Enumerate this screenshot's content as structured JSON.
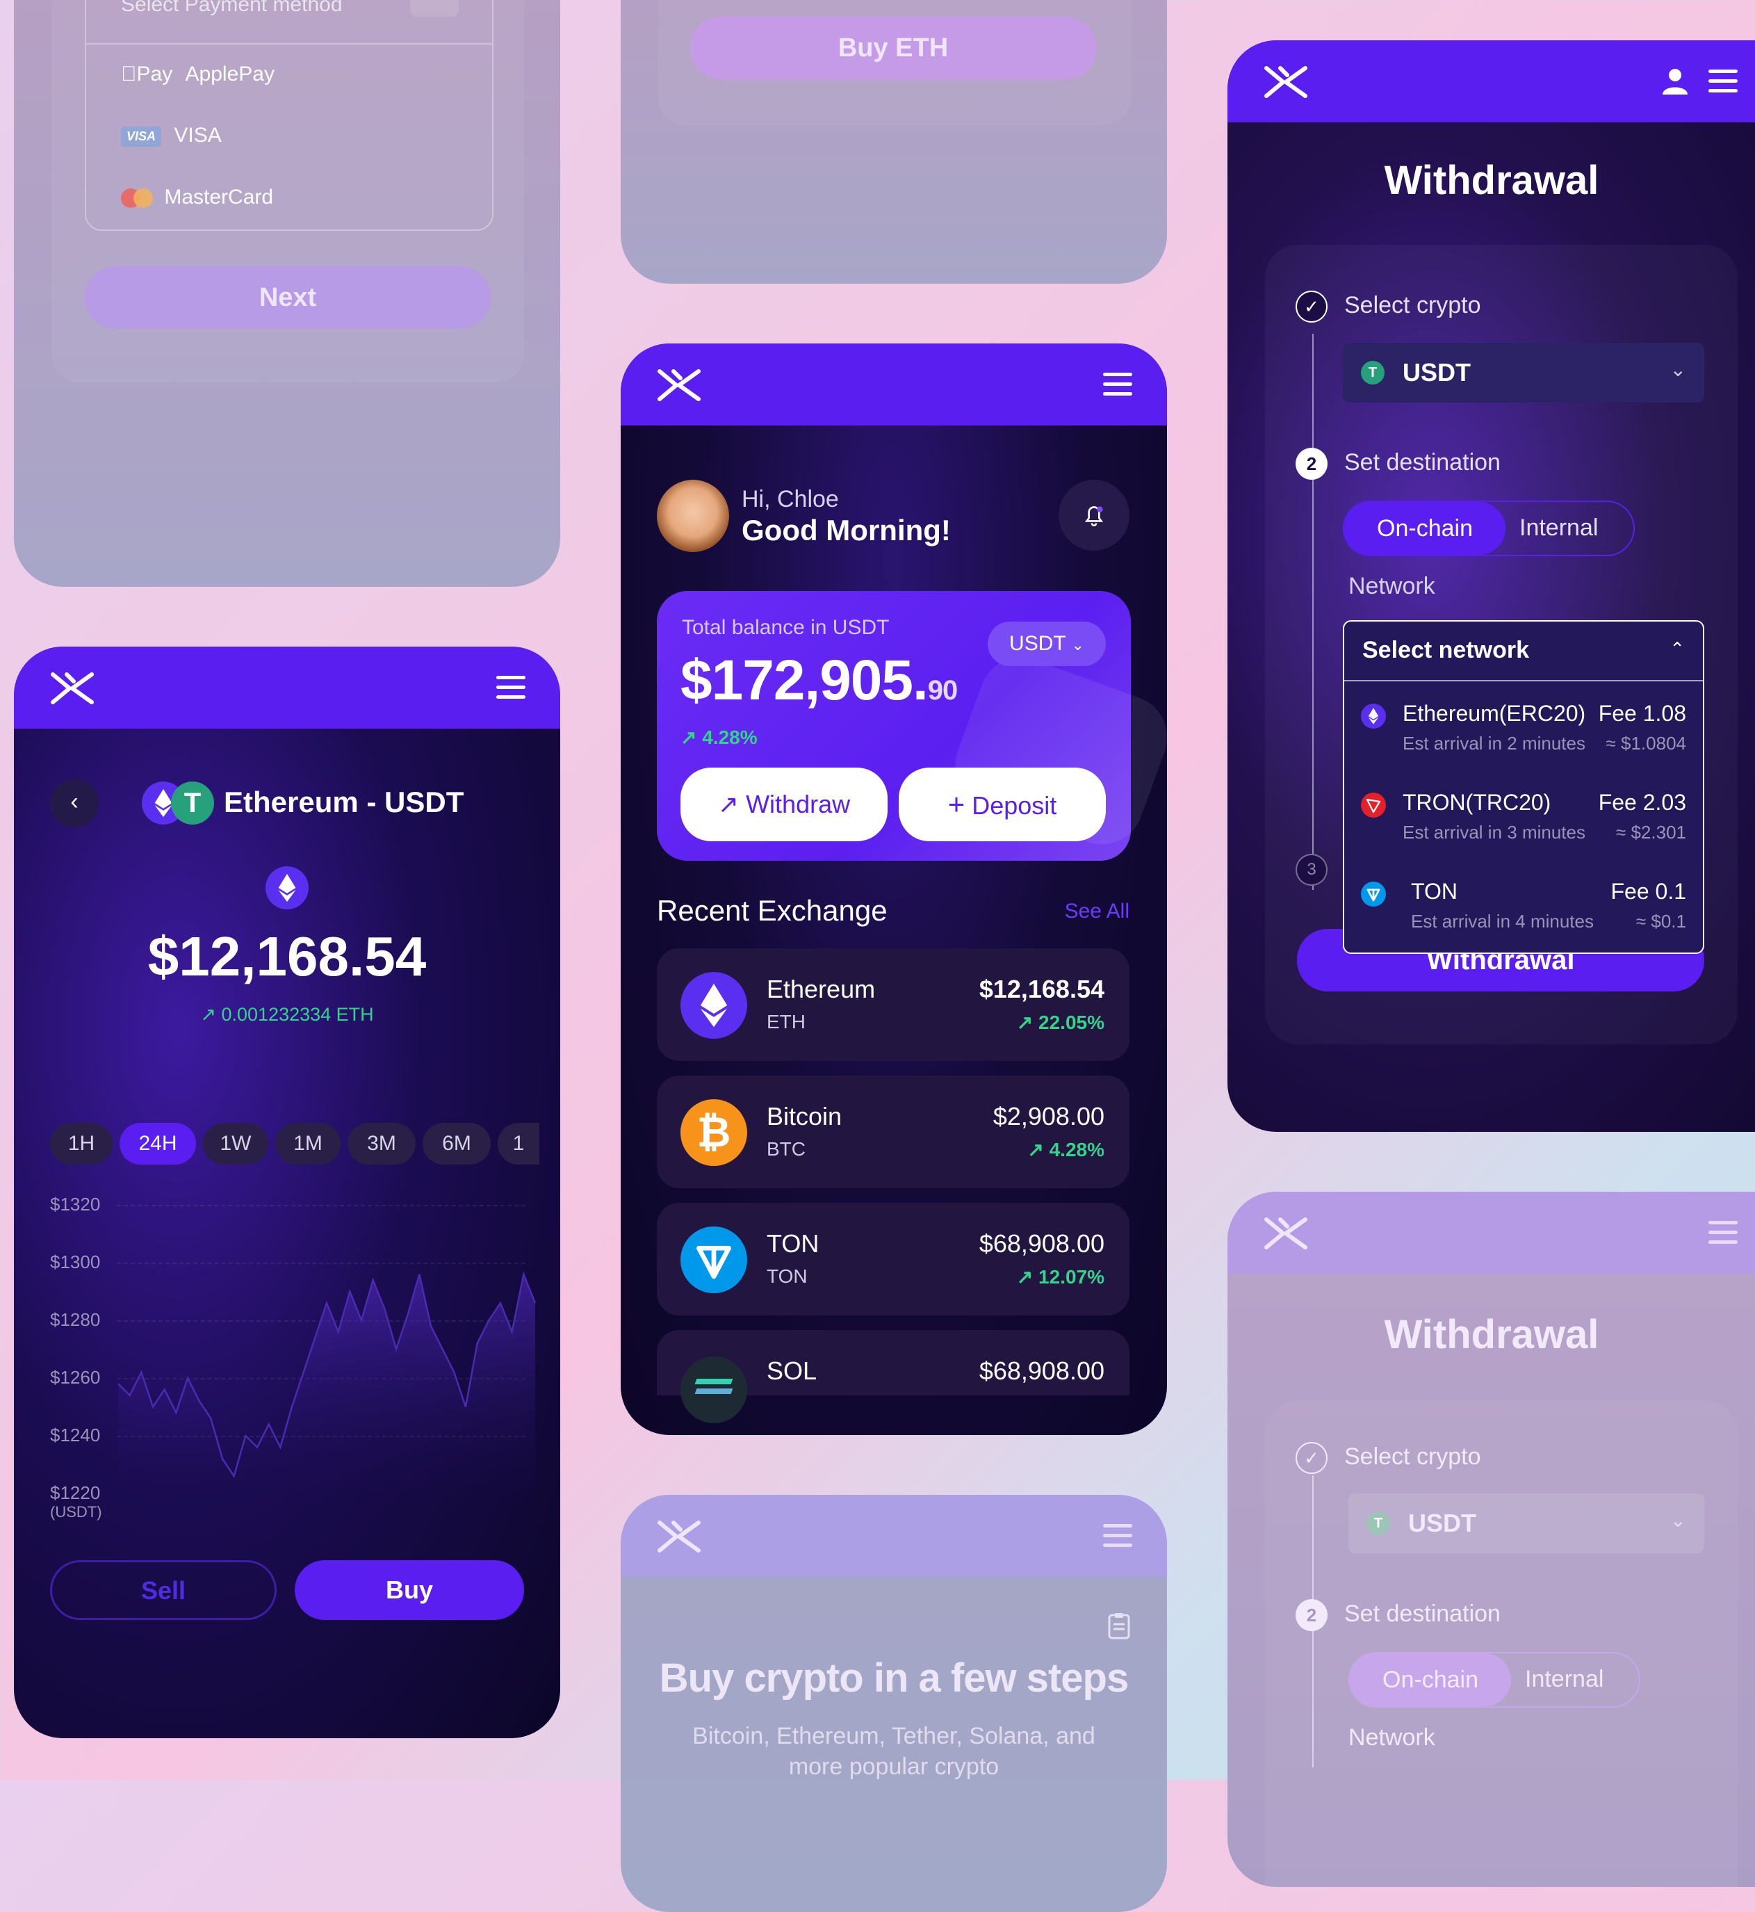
{
  "payment_card": {
    "select_placeholder": "Select Payment method",
    "options": [
      {
        "brand": "Pay",
        "label": "ApplePay"
      },
      {
        "brand": "VISA",
        "label": "VISA"
      },
      {
        "brand": "",
        "label": "MasterCard"
      }
    ],
    "next_label": "Next"
  },
  "buy_card": {
    "buy_label": "Buy ETH"
  },
  "home": {
    "greeting": "Hi, Chloe",
    "salutation": "Good Morning!",
    "balance_label": "Total balance in USDT",
    "currency": "USDT",
    "balance_main": "$172,905.",
    "balance_cents": "90",
    "balance_change": "4.28%",
    "withdraw_label": "Withdraw",
    "deposit_label": "Deposit",
    "recent_title": "Recent Exchange",
    "see_all": "See All",
    "exchanges": [
      {
        "name": "Ethereum",
        "symbol": "ETH",
        "price": "$12,168.54",
        "change": "22.05%"
      },
      {
        "name": "Bitcoin",
        "symbol": "BTC",
        "price": "$2,908.00",
        "change": "4.28%"
      },
      {
        "name": "TON",
        "symbol": "TON",
        "price": "$68,908.00",
        "change": "12.07%"
      },
      {
        "name": "SOL",
        "symbol": "",
        "price": "$68,908.00",
        "change": ""
      }
    ]
  },
  "pair": {
    "title": "Ethereum - USDT",
    "price": "$12,168.54",
    "eth_amount": "0.001232334 ETH",
    "timeframes": [
      "1H",
      "24H",
      "1W",
      "1M",
      "3M",
      "6M",
      "1"
    ],
    "active_timeframe": "24H",
    "y_labels": [
      "$1320",
      "$1300",
      "$1280",
      "$1260",
      "$1240",
      "$1220"
    ],
    "y_unit": "(USDT)",
    "sell_label": "Sell",
    "buy_label": "Buy",
    "chart_data": {
      "type": "area",
      "ylim": [
        1220,
        1330
      ],
      "values": [
        1258,
        1254,
        1262,
        1250,
        1256,
        1248,
        1260,
        1252,
        1246,
        1232,
        1226,
        1240,
        1236,
        1244,
        1236,
        1250,
        1262,
        1274,
        1286,
        1276,
        1290,
        1280,
        1294,
        1284,
        1270,
        1282,
        1296,
        1278,
        1270,
        1262,
        1250,
        1272,
        1280,
        1286,
        1276,
        1296,
        1286
      ]
    }
  },
  "withdrawal": {
    "title": "Withdrawal",
    "step1_label": "Select crypto",
    "crypto": "USDT",
    "step2_num": "2",
    "step2_label": "Set destination",
    "tab_onchain": "On-chain",
    "tab_internal": "Internal",
    "network_label": "Network",
    "select_network": "Select network",
    "step3_num": "3",
    "networks": [
      {
        "name": "Ethereum(ERC20)",
        "fee": "Fee 1.08",
        "arrival": "Est arrival in 2 minutes",
        "approx": "≈ $1.0804"
      },
      {
        "name": "TRON(TRC20)",
        "fee": "Fee 2.03",
        "arrival": "Est arrival in 3 minutes",
        "approx": "≈ $2.301"
      },
      {
        "name": "TON",
        "fee": "Fee 0.1",
        "arrival": "Est arrival in 4 minutes",
        "approx": "≈ $0.1"
      }
    ],
    "submit_label": "Withdrawal"
  },
  "withdrawal_faded": {
    "title": "Withdrawal",
    "step1_label": "Select crypto",
    "crypto": "USDT",
    "step2_num": "2",
    "step2_label": "Set destination",
    "tab_onchain": "On-chain",
    "tab_internal": "Internal",
    "network_label": "Network"
  },
  "steps_card": {
    "title": "Buy crypto in a few steps",
    "subtitle_line1": "Bitcoin, Ethereum, Tether, Solana, and",
    "subtitle_line2": "more popular crypto"
  }
}
